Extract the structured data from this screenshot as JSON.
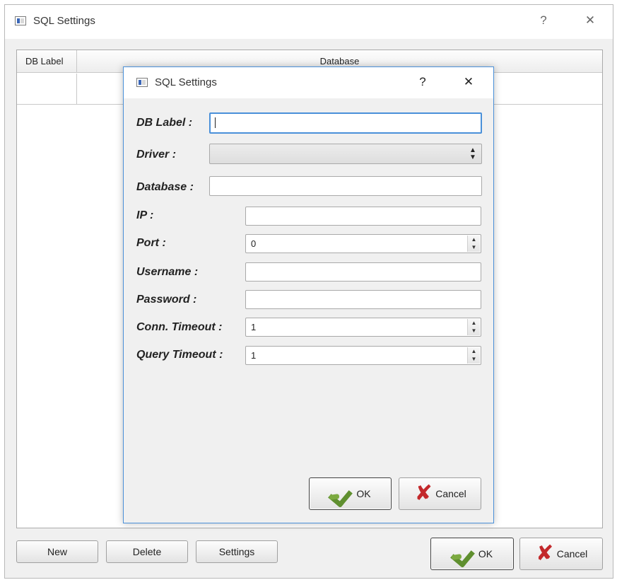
{
  "outer_window": {
    "title": "SQL Settings",
    "help_glyph": "?",
    "close_glyph": "✕",
    "table": {
      "columns": [
        "DB Label",
        "Database"
      ],
      "rows": []
    },
    "buttons": {
      "new": "New",
      "delete": "Delete",
      "settings": "Settings",
      "ok": "OK",
      "cancel": "Cancel"
    }
  },
  "dialog": {
    "title": "SQL Settings",
    "help_glyph": "?",
    "close_glyph": "✕",
    "fields": {
      "db_label": {
        "label": "DB Label :",
        "value": ""
      },
      "driver": {
        "label": "Driver :",
        "value": ""
      },
      "database": {
        "label": "Database :",
        "value": ""
      },
      "ip": {
        "label": "IP :",
        "value": ""
      },
      "port": {
        "label": "Port :",
        "value": "0"
      },
      "username": {
        "label": "Username :",
        "value": ""
      },
      "password": {
        "label": "Password :",
        "value": ""
      },
      "conn_timeout": {
        "label": "Conn. Timeout :",
        "value": "1"
      },
      "query_timeout": {
        "label": "Query Timeout :",
        "value": "1"
      }
    },
    "buttons": {
      "ok": "OK",
      "cancel": "Cancel"
    }
  },
  "colors": {
    "accent": "#4a90d9",
    "ok_icon": "#5f8f2f",
    "cancel_icon": "#c3282b"
  }
}
